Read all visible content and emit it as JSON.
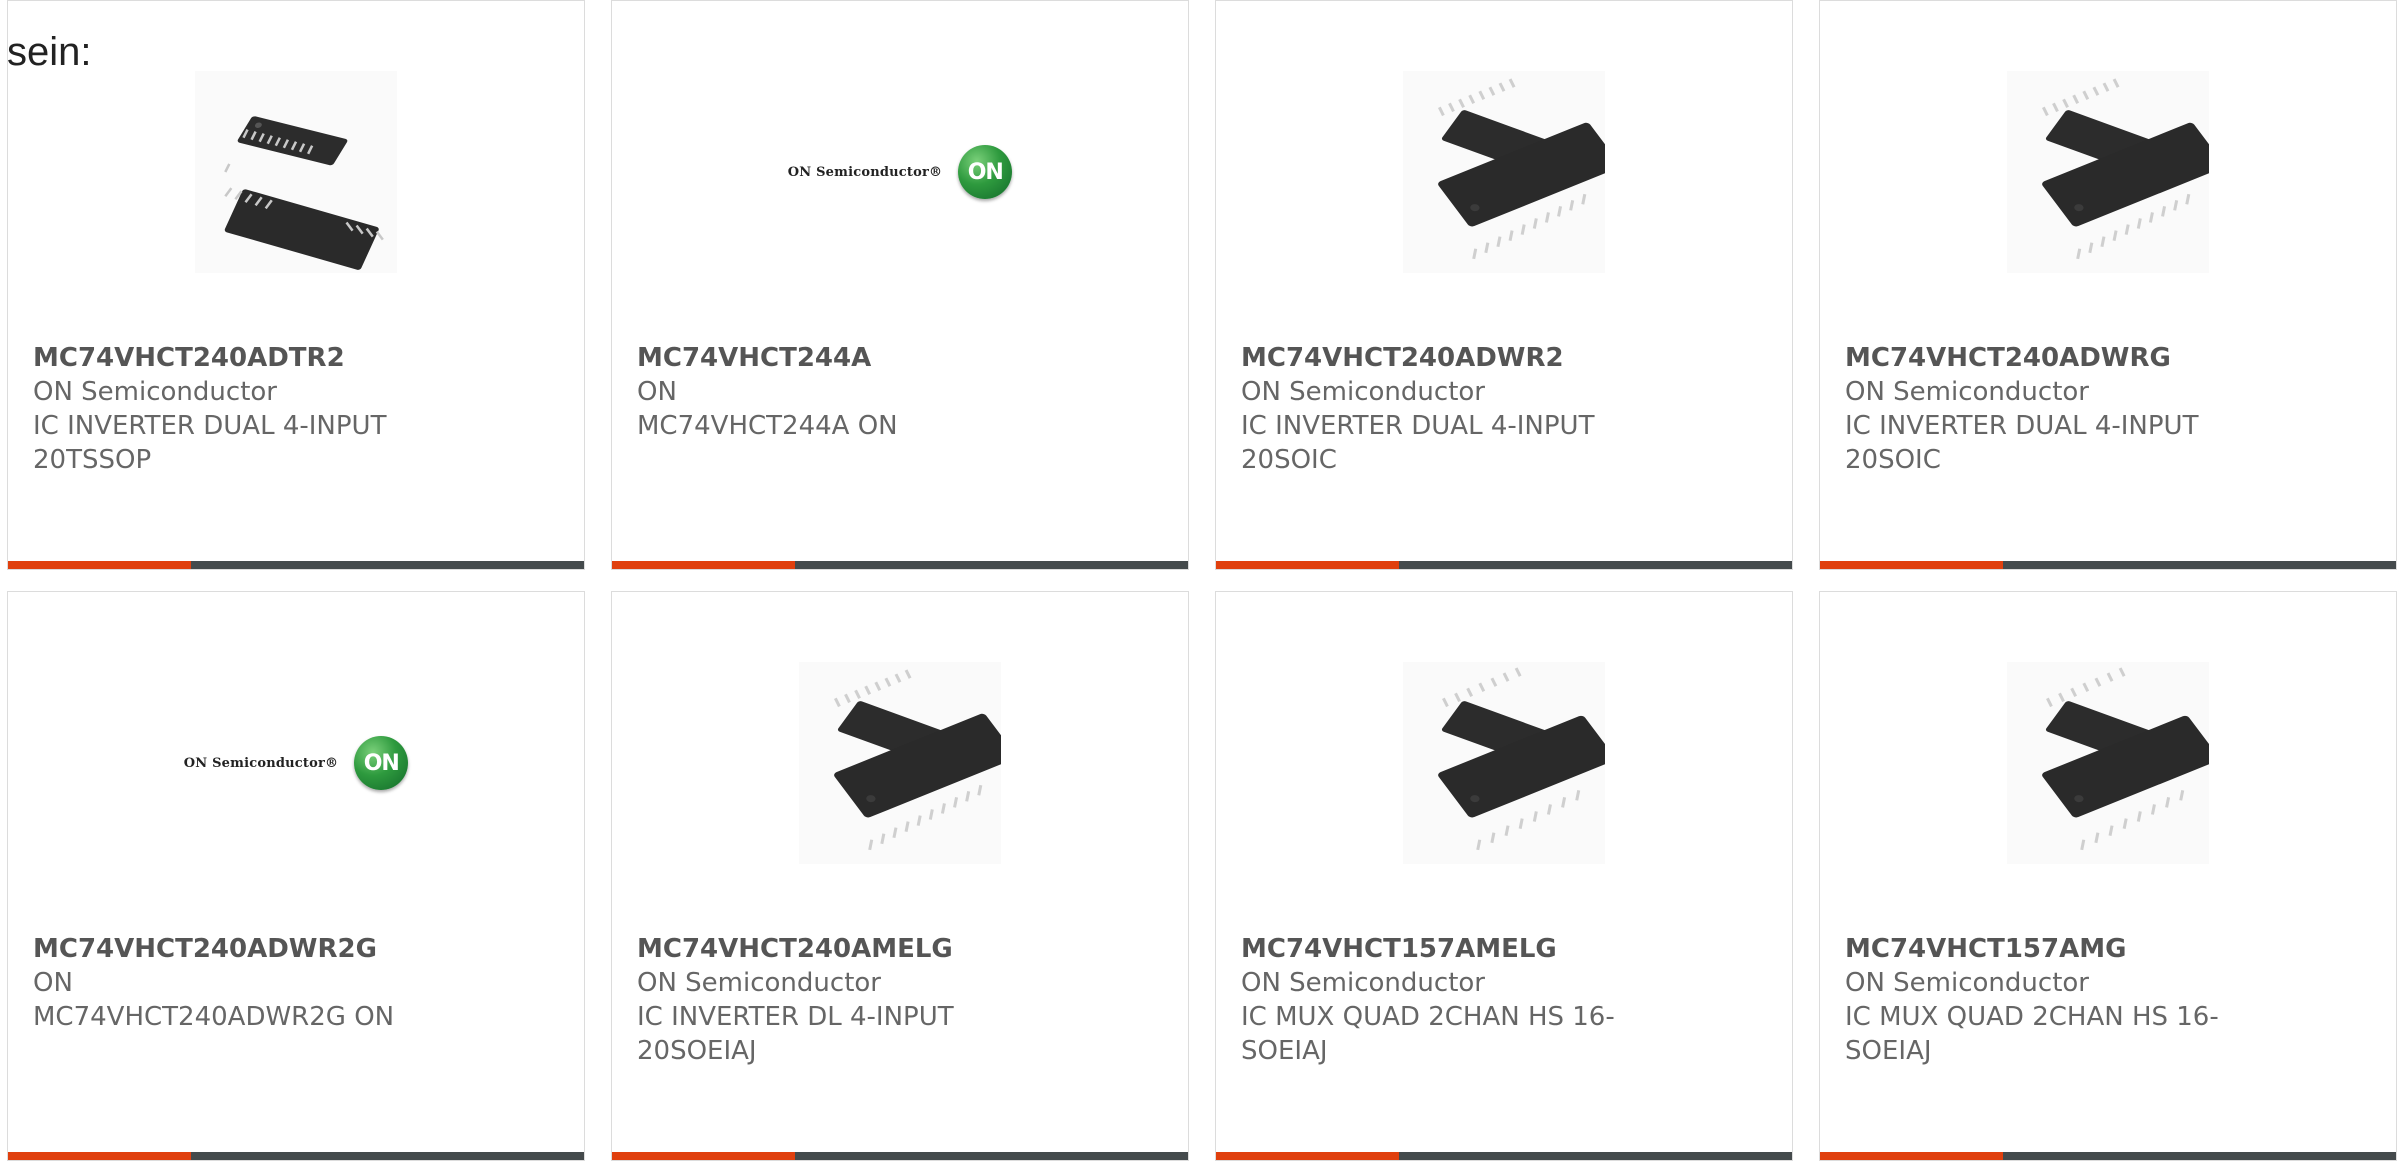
{
  "intro_text": "sein:",
  "colors": {
    "accent": "#e0400e",
    "bar": "#444a4c",
    "border": "#dcdcdc",
    "text": "#666666",
    "logo_green": "#2e9a3e"
  },
  "products": [
    {
      "part_number": "MC74VHCT240ADTR2",
      "manufacturer": "ON Semiconductor",
      "description": "IC INVERTER DUAL 4-INPUT\n20TSSOP",
      "image": "chip-tssop-icon"
    },
    {
      "part_number": "MC74VHCT244A",
      "manufacturer": "ON",
      "description": "MC74VHCT244A ON",
      "image": "on-semiconductor-logo",
      "logo_text": "ON Semiconductor®",
      "logo_badge": "ON"
    },
    {
      "part_number": "MC74VHCT240ADWR2",
      "manufacturer": "ON Semiconductor",
      "description": "IC INVERTER DUAL 4-INPUT\n20SOIC",
      "image": "chip-soic-icon"
    },
    {
      "part_number": "MC74VHCT240ADWRG",
      "manufacturer": "ON Semiconductor",
      "description": "IC INVERTER DUAL 4-INPUT\n20SOIC",
      "image": "chip-soic-icon"
    },
    {
      "part_number": "MC74VHCT240ADWR2G",
      "manufacturer": "ON",
      "description": "MC74VHCT240ADWR2G ON",
      "image": "on-semiconductor-logo",
      "logo_text": "ON Semiconductor®",
      "logo_badge": "ON"
    },
    {
      "part_number": "MC74VHCT240AMELG",
      "manufacturer": "ON Semiconductor",
      "description": "IC INVERTER DL 4-INPUT\n20SOEIAJ",
      "image": "chip-soic-icon"
    },
    {
      "part_number": "MC74VHCT157AMELG",
      "manufacturer": "ON Semiconductor",
      "description": "IC MUX QUAD 2CHAN HS 16-\nSOEIAJ",
      "image": "chip-soic-16-icon"
    },
    {
      "part_number": "MC74VHCT157AMG",
      "manufacturer": "ON Semiconductor",
      "description": "IC MUX QUAD 2CHAN HS 16-\nSOEIAJ",
      "image": "chip-soic-16-icon"
    }
  ]
}
